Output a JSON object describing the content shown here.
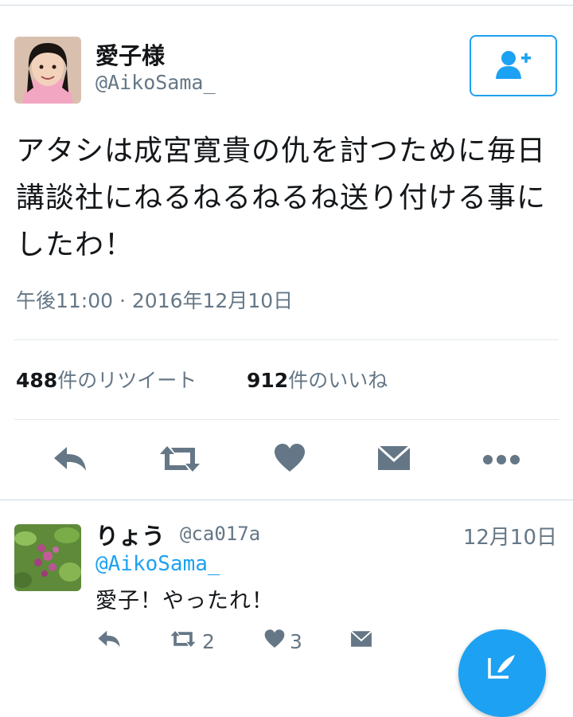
{
  "tweet": {
    "user": {
      "name": "愛子様",
      "handle": "@AikoSama_"
    },
    "text": "アタシは成宮寛貴の仇を討つために毎日講談社にねるねるねるね送り付ける事にしたわ！",
    "timestamp": "午後11:00 · 2016年12月10日",
    "stats": {
      "retweets_count": "488",
      "retweets_label": "件のリツイート",
      "likes_count": "912",
      "likes_label": "件のいいね"
    }
  },
  "icons": {
    "follow": "add-user-icon",
    "reply": "reply-icon",
    "retweet": "retweet-icon",
    "like": "heart-icon",
    "message": "envelope-icon",
    "more": "more-icon",
    "compose": "compose-icon"
  },
  "reply": {
    "user": {
      "name": "りょう",
      "handle": "@ca017a"
    },
    "date": "12月10日",
    "mention": "@AikoSama_",
    "text": "愛子！やったれ！",
    "retweet_count": "2",
    "like_count": "3"
  },
  "colors": {
    "accent": "#1da1f2",
    "action_gray": "#657786",
    "divider": "#cfd9e0"
  }
}
